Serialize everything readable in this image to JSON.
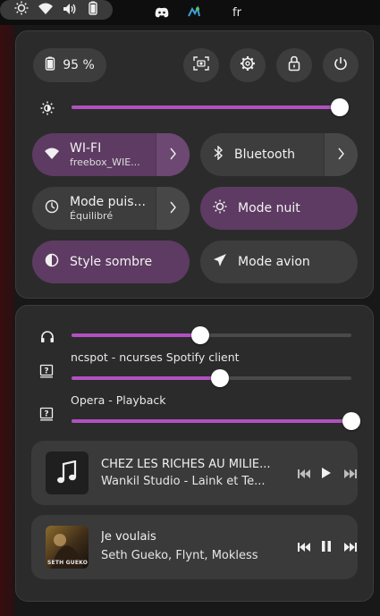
{
  "topbar": {
    "lang": "fr",
    "icons": [
      "discord-icon",
      "app-indicator-icon",
      "brightness-icon",
      "wifi-icon",
      "volume-icon",
      "battery-icon"
    ]
  },
  "quick_settings": {
    "battery_label": "95 %",
    "buttons": [
      "screenshot-icon",
      "settings-icon",
      "lock-icon",
      "power-icon"
    ],
    "brightness_level": 0.98,
    "tiles": [
      {
        "title": "WI-FI",
        "subtitle": "freebox_WIE...",
        "active": true,
        "has_menu": true
      },
      {
        "title": "Bluetooth",
        "subtitle": "",
        "active": false,
        "has_menu": true
      },
      {
        "title": "Mode puis...",
        "subtitle": "Équilibré",
        "active": false,
        "has_menu": true
      },
      {
        "title": "Mode nuit",
        "subtitle": "",
        "active": true,
        "has_menu": false
      },
      {
        "title": "Style sombre",
        "subtitle": "",
        "active": true,
        "has_menu": false
      },
      {
        "title": "Mode avion",
        "subtitle": "",
        "active": false,
        "has_menu": false
      }
    ]
  },
  "audio": {
    "output_level": 0.46,
    "apps": [
      {
        "name": "ncspot - ncurses Spotify client",
        "level": 0.53
      },
      {
        "name": "Opera - Playback",
        "level": 1.0
      }
    ]
  },
  "media": [
    {
      "title": "CHEZ LES RICHES AU MILIE...",
      "artist": "Wankil Studio - Laink et Te...",
      "state": "paused",
      "art": "music-note-icon"
    },
    {
      "title": "Je voulais",
      "artist": "Seth Gueko, Flynt, Mokless",
      "state": "playing",
      "art": "album-cover",
      "art_text": "SETH GUEKO"
    }
  ],
  "colors": {
    "accent": "#b151c0",
    "tile_on": "#5e3b63",
    "tile_off": "#3d3d3d",
    "panel": "#2b2b2b"
  }
}
